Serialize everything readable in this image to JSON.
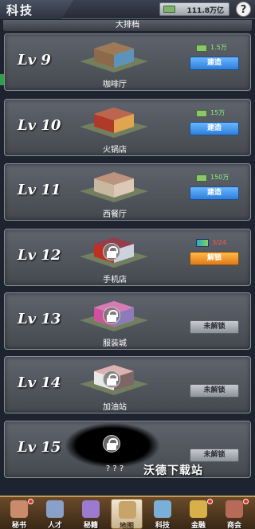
{
  "header": {
    "title": "科技",
    "money": "111.8万亿",
    "help_label": "?"
  },
  "top_strip": {
    "label": "大排档"
  },
  "buildings": [
    {
      "level": "Lv 9",
      "name": "咖啡厅",
      "price": "1.5万",
      "price_kind": "cash",
      "button": "建造",
      "button_style": "blue",
      "locked": false
    },
    {
      "level": "Lv 10",
      "name": "火锅店",
      "price": "15万",
      "price_kind": "cash",
      "button": "建造",
      "button_style": "blue",
      "locked": false
    },
    {
      "level": "Lv 11",
      "name": "西餐厅",
      "price": "150万",
      "price_kind": "cash",
      "button": "建造",
      "button_style": "blue",
      "locked": false
    },
    {
      "level": "Lv 12",
      "name": "手机店",
      "price": "3/24",
      "price_kind": "card",
      "button": "解锁",
      "button_style": "orange",
      "locked": true
    },
    {
      "level": "Lv 13",
      "name": "服装城",
      "price": "",
      "price_kind": "none",
      "button": "未解锁",
      "button_style": "gray",
      "locked": true
    },
    {
      "level": "Lv 14",
      "name": "加油站",
      "price": "",
      "price_kind": "none",
      "button": "未解锁",
      "button_style": "gray",
      "locked": true
    },
    {
      "level": "Lv 15",
      "name": "? ? ?",
      "price": "",
      "price_kind": "none",
      "button": "未解锁",
      "button_style": "gray",
      "locked": true,
      "hidden": true
    }
  ],
  "watermark": "沃德下载站",
  "bottom_nav": [
    {
      "label": "秘书",
      "icon": "secretary-icon",
      "color": "#c98b6a",
      "badge": true
    },
    {
      "label": "人才",
      "icon": "talent-icon",
      "color": "#8aa0c8",
      "badge": false
    },
    {
      "label": "秘籍",
      "icon": "book-icon",
      "color": "#9b7ad0",
      "badge": false
    },
    {
      "label": "地图",
      "icon": "map-icon",
      "color": "#c8a46a",
      "badge": false,
      "active": true
    },
    {
      "label": "科技",
      "icon": "tech-icon",
      "color": "#7ab0d8",
      "badge": false
    },
    {
      "label": "金融",
      "icon": "finance-icon",
      "color": "#d8b04a",
      "badge": true
    },
    {
      "label": "商会",
      "icon": "chamber-icon",
      "color": "#b86a5a",
      "badge": true
    }
  ],
  "colors": {
    "price_green": "#8bf07a",
    "price_red": "#ff5a4a",
    "build_blue": "#2e7fdc",
    "unlock_orange": "#e07a18"
  }
}
